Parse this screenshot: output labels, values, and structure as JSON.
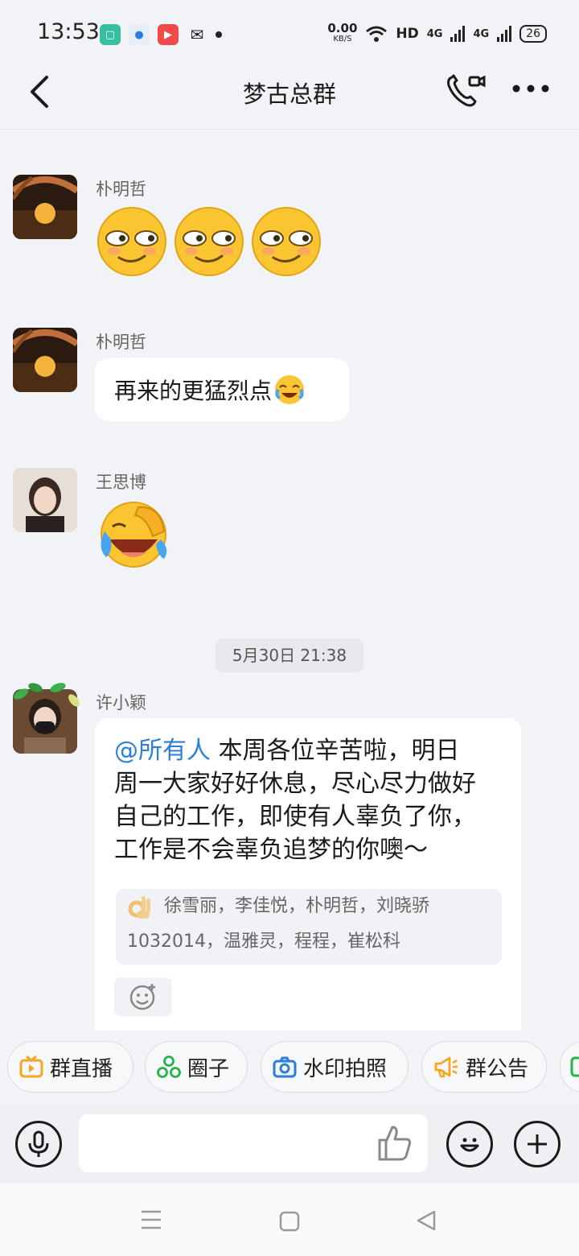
{
  "status_bar": {
    "time": "13:53",
    "speed_value": "0.00",
    "speed_unit": "KB/S",
    "hd_label": "HD",
    "net1": "4G",
    "net2": "4G",
    "battery": "26"
  },
  "header": {
    "title": "梦古总群",
    "back_icon": "chevron-left-icon",
    "call_icon": "phone-video-icon",
    "more_icon": "more-dots-icon"
  },
  "messages": [
    {
      "sender": "朴明哲",
      "type": "emoji",
      "content": [
        "smirk-face",
        "smirk-face",
        "smirk-face"
      ]
    },
    {
      "sender": "朴明哲",
      "type": "text",
      "text": "再来的更猛烈点"
    },
    {
      "sender": "王思博",
      "type": "emoji",
      "content": [
        "crying-laughing-face"
      ]
    }
  ],
  "timestamp": "5月30日 21:38",
  "announcement_message": {
    "sender": "许小颖",
    "mention": "@所有人",
    "lines": [
      " 本周各位辛苦啦，明日",
      "周一大家好好休息，尽心尽力做好",
      "自己的工作，即使有人辜负了你，",
      "工作是不会辜负追梦的你噢～"
    ],
    "reaction_line1": "徐雪丽，李佳悦，朴明哲，刘晓骄",
    "reaction_line2": "1032014，温雅灵，程程，崔松科"
  },
  "quick_actions": [
    {
      "label": "群直播",
      "icon": "tv-icon",
      "color": "#f5a623"
    },
    {
      "label": "圈子",
      "icon": "circles-icon",
      "color": "#25b24a"
    },
    {
      "label": "水印拍照",
      "icon": "camera-icon",
      "color": "#2b7fd8"
    },
    {
      "label": "群公告",
      "icon": "megaphone-icon",
      "color": "#f5a623"
    }
  ],
  "input_bar": {
    "voice_icon": "microphone-icon",
    "like_icon": "thumbs-up-icon",
    "emoji_icon": "smile-icon",
    "plus_icon": "plus-icon"
  },
  "colors": {
    "background": "#f2f3f7",
    "bubble": "#ffffff",
    "mention": "#2b7fd8"
  }
}
